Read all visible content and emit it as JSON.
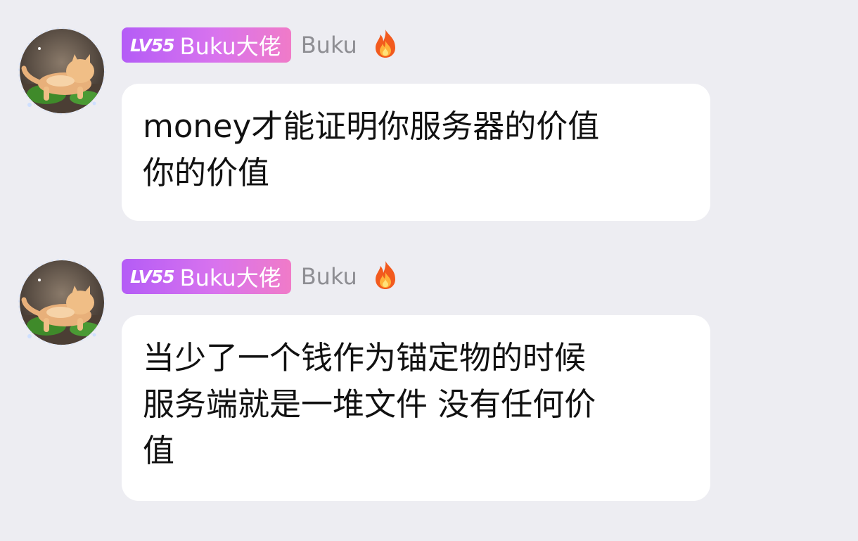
{
  "messages": [
    {
      "sender": {
        "level": "LV55",
        "title": "Buku大佬",
        "name": "Buku"
      },
      "lines": [
        "money才能证明你服务器的价值",
        "你的价值"
      ]
    },
    {
      "sender": {
        "level": "LV55",
        "title": "Buku大佬",
        "name": "Buku"
      },
      "lines": [
        "当少了一个钱作为锚定物的时候",
        "服务端就是一堆文件 没有任何价",
        "值"
      ]
    }
  ],
  "icons": {
    "avatar": "cat-photo-avatar",
    "streak": "fire-icon"
  },
  "colors": {
    "background": "#EDEDF2",
    "bubble": "#FFFFFF",
    "badge_gradient_start": "#B45CF6",
    "badge_gradient_end": "#F07BC8",
    "nickname": "#8E8E93"
  }
}
